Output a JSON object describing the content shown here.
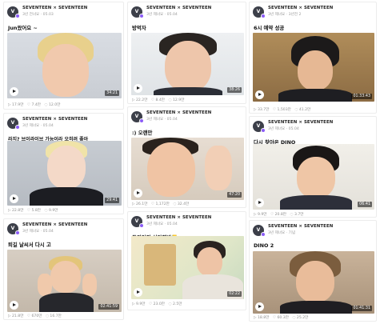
{
  "channel_name": "SEVENTEEN × SEVENTEEN",
  "avatar_text": "V",
  "videos": [
    {
      "timestamp": "3년 전녀요 · 05.03",
      "title": "Jun왔어요 ~",
      "duration": "34:21",
      "plays": "17.9만",
      "likes": "7.4만",
      "comments": "12.0만"
    },
    {
      "timestamp": "3년 제녀요 · 05.04",
      "title": "방먹자",
      "duration": "38:26",
      "plays": "22.2만",
      "likes": "8.4만",
      "comments": "12.9만"
    },
    {
      "timestamp": "3년 제녀요 · 3년전 2",
      "title": "6시 예약 성공",
      "duration": "01:33:43",
      "plays": "33.7만",
      "likes": "1,503만",
      "comments": "41.2만"
    },
    {
      "timestamp": "3년 제녀요 · 05.04",
      "title": "라지? 브이라이브 가능이라 오히려 좋아",
      "duration": "29:41",
      "plays": "22.8만",
      "likes": "5.8만",
      "comments": "9.9만"
    },
    {
      "timestamp": "3년 제녀요 · 05.04",
      "title": ":) 오랜만",
      "duration": "47:20",
      "plays": "26.1만",
      "likes": "1,172만",
      "comments": "32.4만"
    },
    {
      "timestamp": "3년 제녀요 · 05.04",
      "title": "다시 찾아온 DINO",
      "duration": "06:41",
      "plays": "9.9만",
      "likes": "20.8만",
      "comments": "3.7만"
    },
    {
      "timestamp": "3년 제녀요 · 05.04",
      "title": "퇴길 날씨서 다시 고",
      "duration": "02:41:59",
      "plays": "21.8만",
      "likes": "670만",
      "comments": "16.7만"
    },
    {
      "timestamp": "3년 제녀요 · 05.04",
      "title": "도겸이의 심야책방📒",
      "duration": "02:22",
      "plays": "9.9만",
      "likes": "23.0만",
      "comments": "2.5만"
    },
    {
      "timestamp": "3년 제녀요 · 기념",
      "title": "DINO 2",
      "duration": "01:41:31",
      "plays": "18.8만",
      "likes": "60.3만",
      "comments": "25.2만"
    }
  ]
}
